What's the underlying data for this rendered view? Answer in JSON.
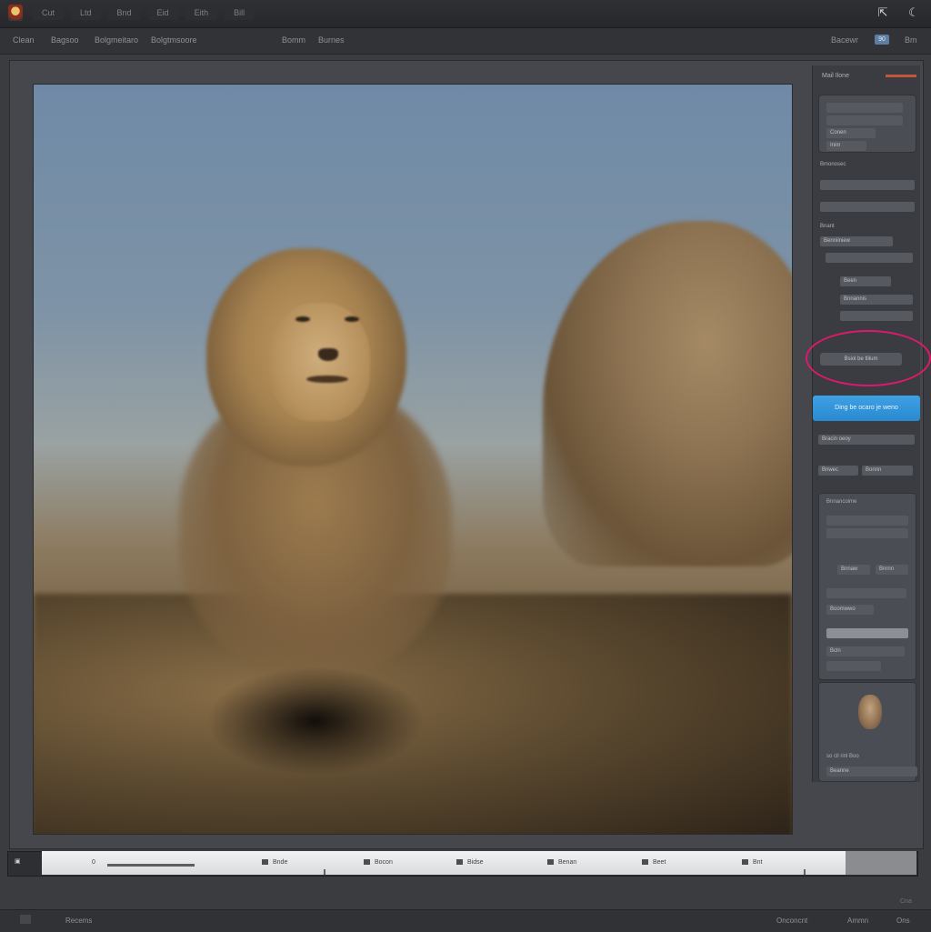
{
  "titlebar": {
    "menu": [
      "Cut",
      "Ltd",
      "Bnd",
      "Eid",
      "Eith",
      "Bill"
    ],
    "controls": {
      "minimize_glyph": "⇱",
      "close_glyph": "☾"
    }
  },
  "toolbar": {
    "items": [
      "Clean",
      "Bagsoo",
      "Bolgmeitaro",
      "Bolgtmsoore",
      "Bomm",
      "Burnes"
    ],
    "right_label": "Bacewr",
    "zoom_value": "90",
    "right_end": "Bm"
  },
  "panel": {
    "header": "Mail Ilone",
    "rows_card1": [
      "Conen",
      "Inim"
    ],
    "label_1": "Bmonosec",
    "label_2": "Bnant",
    "rows_section2": [
      "Benniiniew",
      "Been",
      "Bnnannis"
    ],
    "highlighted_field": "Bsiol be tlilum",
    "primary_button": "Ding be ocaro je weno",
    "rows_section3": [
      "Bracin oeoy",
      "Bnwec",
      "Bonnn"
    ],
    "label_3": "Bnnancoime",
    "rows_section4": [
      "Bnnaw",
      "Bnrnn",
      "Boomwwo",
      "Bcln"
    ],
    "footer_text": "so cll rinl Boo",
    "footer_row": "Beanne"
  },
  "timeline": {
    "start_label": "0",
    "items": [
      "Bnde",
      "Bocon",
      "Bidse",
      "Benan",
      "Beet",
      "Bnt"
    ]
  },
  "status": {
    "left": "Recems",
    "right_1": "Onconcnt",
    "right_2": "Ammn",
    "right_3": "Ons",
    "corner": "Cna"
  },
  "colors": {
    "accent": "#2a8ad0",
    "highlight": "#e0186c",
    "panel_accent": "#c0563b"
  },
  "icons": {
    "app": "app-logo-icon",
    "timeline_play": "play-icon",
    "timeline_item": "marker-icon"
  }
}
